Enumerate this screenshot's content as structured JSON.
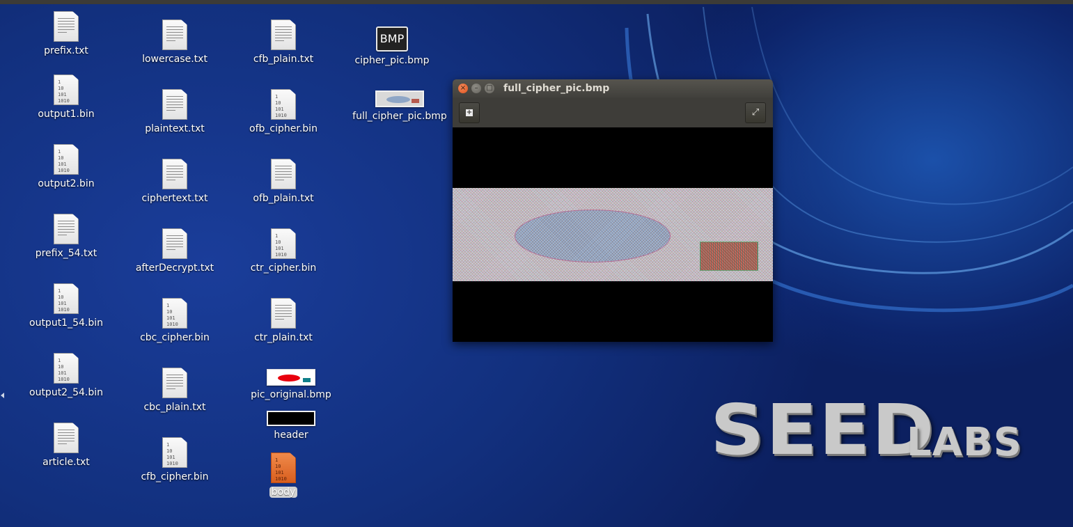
{
  "desktop": {
    "icons": [
      {
        "label": "prefix.txt",
        "kind": "text"
      },
      {
        "label": "output1.bin",
        "kind": "binary"
      },
      {
        "label": "output2.bin",
        "kind": "binary"
      },
      {
        "label": "prefix_54.txt",
        "kind": "text"
      },
      {
        "label": "output1_54.bin",
        "kind": "binary"
      },
      {
        "label": "output2_54.bin",
        "kind": "binary"
      },
      {
        "label": "article.txt",
        "kind": "text"
      },
      {
        "label": "lowercase.txt",
        "kind": "text"
      },
      {
        "label": "plaintext.txt",
        "kind": "text"
      },
      {
        "label": "ciphertext.txt",
        "kind": "text"
      },
      {
        "label": "afterDecrypt.txt",
        "kind": "text"
      },
      {
        "label": "cbc_cipher.bin",
        "kind": "binary"
      },
      {
        "label": "cbc_plain.txt",
        "kind": "text"
      },
      {
        "label": "cfb_cipher.bin",
        "kind": "binary"
      },
      {
        "label": "cfb_plain.txt",
        "kind": "text"
      },
      {
        "label": "ofb_cipher.bin",
        "kind": "binary"
      },
      {
        "label": "ofb_plain.txt",
        "kind": "text"
      },
      {
        "label": "ctr_cipher.bin",
        "kind": "binary"
      },
      {
        "label": "ctr_plain.txt",
        "kind": "text"
      },
      {
        "label": "pic_original.bmp",
        "kind": "image"
      },
      {
        "label": "header",
        "kind": "image"
      },
      {
        "label": "body",
        "kind": "binary",
        "selected": true
      },
      {
        "label": "cipher_pic.bmp",
        "kind": "image"
      },
      {
        "label": "full_cipher_pic.bmp",
        "kind": "image"
      }
    ],
    "binary_glyph": [
      "1",
      "10",
      "101",
      "1010"
    ],
    "bmp_icon_text": "BMP"
  },
  "viewer": {
    "title": "full_cipher_pic.bmp",
    "close_glyph": "×",
    "minimize_glyph": "–",
    "maximize_glyph": "□",
    "add_glyph": "+",
    "fullscreen_glyph": "⤢"
  },
  "wallpaper": {
    "logo_main": "SEED",
    "logo_sub": "LABS"
  },
  "colors": {
    "desktop_blue": "#12307e",
    "titlebar": "#403f3b",
    "close_button": "#e0531f",
    "selection": "#d2d2d2",
    "body_file": "#d85e1e"
  }
}
